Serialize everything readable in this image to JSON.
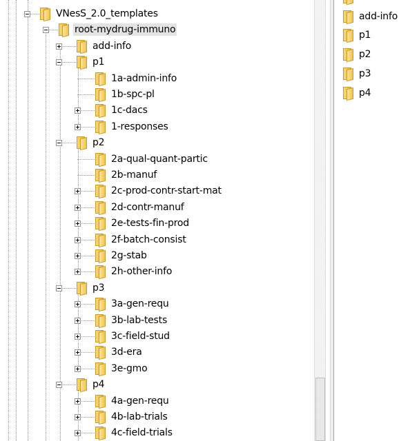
{
  "tree": [
    {
      "label": "VNesS_2.0_templates",
      "toggle": "minus",
      "level": 0
    },
    {
      "label": "root-mydrug-immuno",
      "toggle": "minus",
      "level": 1,
      "selected": true
    },
    {
      "label": "add-info",
      "toggle": "plus",
      "level": 2
    },
    {
      "label": "p1",
      "toggle": "minus",
      "level": 2
    },
    {
      "label": "1a-admin-info",
      "toggle": "none",
      "level": 3
    },
    {
      "label": "1b-spc-pl",
      "toggle": "none",
      "level": 3
    },
    {
      "label": "1c-dacs",
      "toggle": "plus",
      "level": 3
    },
    {
      "label": "1-responses",
      "toggle": "plus",
      "level": 3
    },
    {
      "label": "p2",
      "toggle": "minus",
      "level": 2
    },
    {
      "label": "2a-qual-quant-partic",
      "toggle": "none",
      "level": 3
    },
    {
      "label": "2b-manuf",
      "toggle": "none",
      "level": 3
    },
    {
      "label": "2c-prod-contr-start-mat",
      "toggle": "plus",
      "level": 3
    },
    {
      "label": "2d-contr-manuf",
      "toggle": "plus",
      "level": 3
    },
    {
      "label": "2e-tests-fin-prod",
      "toggle": "plus",
      "level": 3
    },
    {
      "label": "2f-batch-consist",
      "toggle": "plus",
      "level": 3
    },
    {
      "label": "2g-stab",
      "toggle": "plus",
      "level": 3
    },
    {
      "label": "2h-other-info",
      "toggle": "plus",
      "level": 3
    },
    {
      "label": "p3",
      "toggle": "minus",
      "level": 2
    },
    {
      "label": "3a-gen-requ",
      "toggle": "plus",
      "level": 3
    },
    {
      "label": "3b-lab-tests",
      "toggle": "plus",
      "level": 3
    },
    {
      "label": "3c-field-stud",
      "toggle": "plus",
      "level": 3
    },
    {
      "label": "3d-era",
      "toggle": "plus",
      "level": 3
    },
    {
      "label": "3e-gmo",
      "toggle": "plus",
      "level": 3
    },
    {
      "label": "p4",
      "toggle": "minus",
      "level": 2
    },
    {
      "label": "4a-gen-requ",
      "toggle": "plus",
      "level": 3
    },
    {
      "label": "4b-lab-trials",
      "toggle": "plus",
      "level": 3
    },
    {
      "label": "4c-field-trials",
      "toggle": "plus",
      "level": 3
    }
  ],
  "file_list": [
    {
      "label": ".."
    },
    {
      "label": "add-info"
    },
    {
      "label": "p1"
    },
    {
      "label": "p2"
    },
    {
      "label": "p3"
    },
    {
      "label": "p4"
    }
  ],
  "icons": {
    "folder": "folder-icon",
    "expand": "plus-box-icon",
    "collapse": "minus-box-icon"
  },
  "colors": {
    "folder_fill": "#f2c352",
    "folder_border": "#c89a2a",
    "selection": "#e3e3e3",
    "tree_lines": "#9a9a9a"
  }
}
